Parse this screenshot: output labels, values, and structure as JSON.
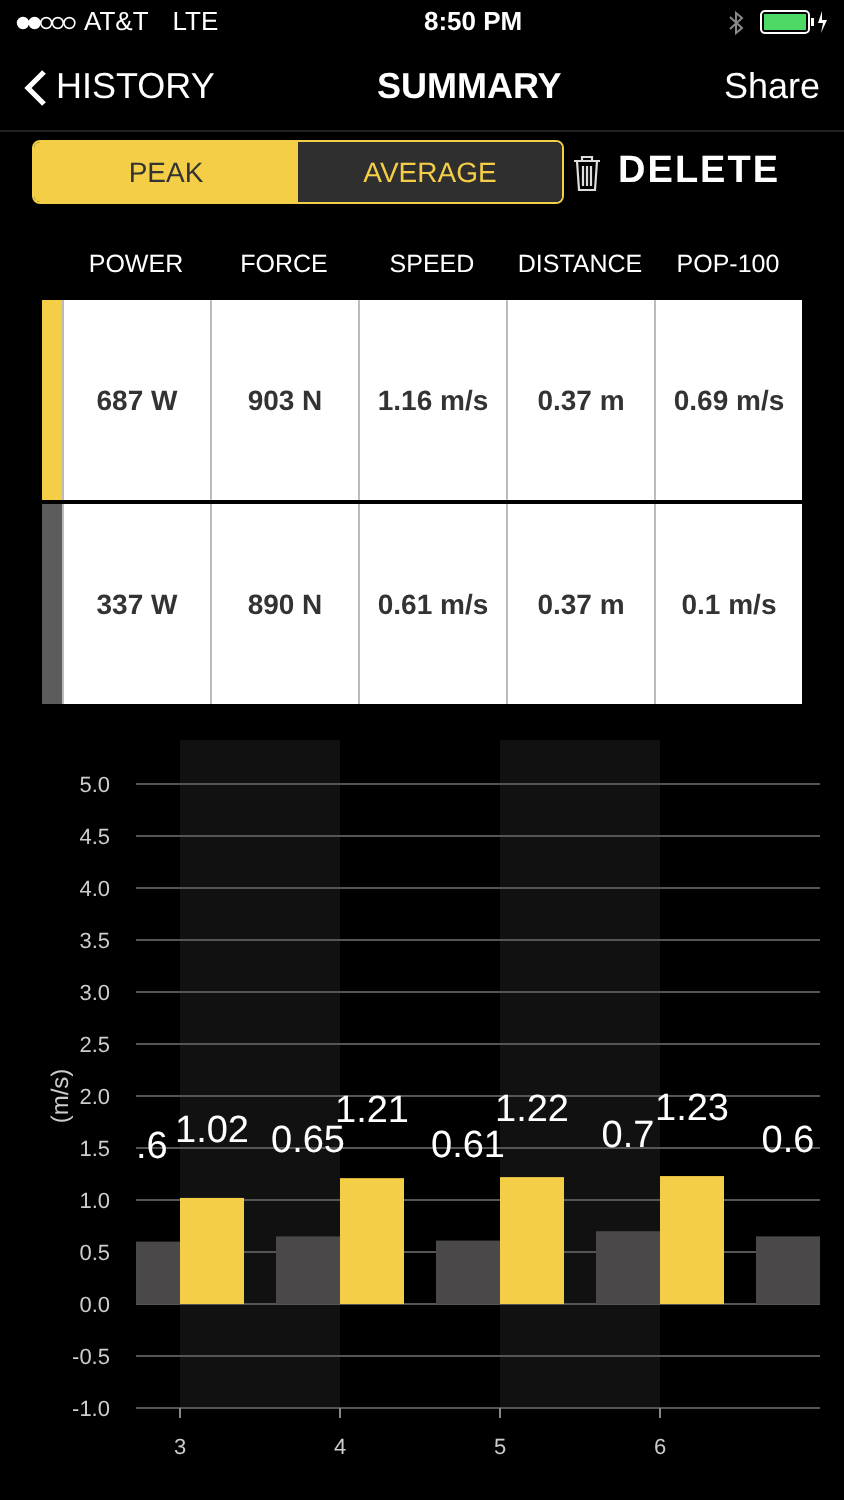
{
  "status_bar": {
    "carrier": "AT&T",
    "network": "LTE",
    "time": "8:50 PM"
  },
  "nav": {
    "back": "HISTORY",
    "title": "SUMMARY",
    "action": "Share"
  },
  "segments": [
    {
      "label": "PEAK",
      "selected": true
    },
    {
      "label": "AVERAGE",
      "selected": false
    }
  ],
  "delete_button": "DELETE",
  "table": {
    "columns": [
      "POWER",
      "FORCE",
      "SPEED",
      "DISTANCE",
      "POP-100"
    ],
    "rows": [
      {
        "color": "#f5ce47",
        "cells": [
          "687 W",
          "903 N",
          "1.16 m/s",
          "0.37 m",
          "0.69 m/s"
        ]
      },
      {
        "color": "#5c5c5c",
        "cells": [
          "337 W",
          "890 N",
          "0.61 m/s",
          "0.37 m",
          "0.1 m/s"
        ]
      }
    ]
  },
  "chart_data": {
    "type": "bar",
    "ylabel": "(m/s)",
    "x": [
      3,
      4,
      5,
      6,
      7
    ],
    "xlim": [
      2.725,
      7
    ],
    "grid": true,
    "ylim": [
      -1,
      5
    ],
    "xticks": [
      3,
      4,
      5,
      6
    ],
    "yticks": [
      {
        "value": -1,
        "label": "-1.0"
      },
      {
        "value": -0.5,
        "label": "-0.5"
      },
      {
        "value": 0,
        "label": "0.0"
      },
      {
        "value": 0.5,
        "label": "0.5"
      },
      {
        "value": 1,
        "label": "1.0"
      },
      {
        "value": 1.5,
        "label": "1.5"
      },
      {
        "value": 2,
        "label": "2.0"
      },
      {
        "value": 2.5,
        "label": "2.5"
      },
      {
        "value": 3,
        "label": "3.0"
      },
      {
        "value": 3.5,
        "label": "3.5"
      },
      {
        "value": 4,
        "label": "4.0"
      },
      {
        "value": 4.5,
        "label": "4.5"
      },
      {
        "value": 5,
        "label": "5.0"
      }
    ],
    "series": [
      {
        "color": "#4a4849",
        "values": [
          0.6,
          0.65,
          0.61,
          0.7,
          0.65
        ]
      },
      {
        "color": "#f5ce47",
        "values": [
          1.02,
          1.21,
          1.22,
          1.23,
          null
        ]
      }
    ],
    "value_labels": [
      [
        ".6",
        "0.65",
        "0.61",
        "0.7",
        "0.6"
      ],
      [
        "1.02",
        "1.21",
        "1.22",
        "1.23",
        null
      ]
    ]
  }
}
